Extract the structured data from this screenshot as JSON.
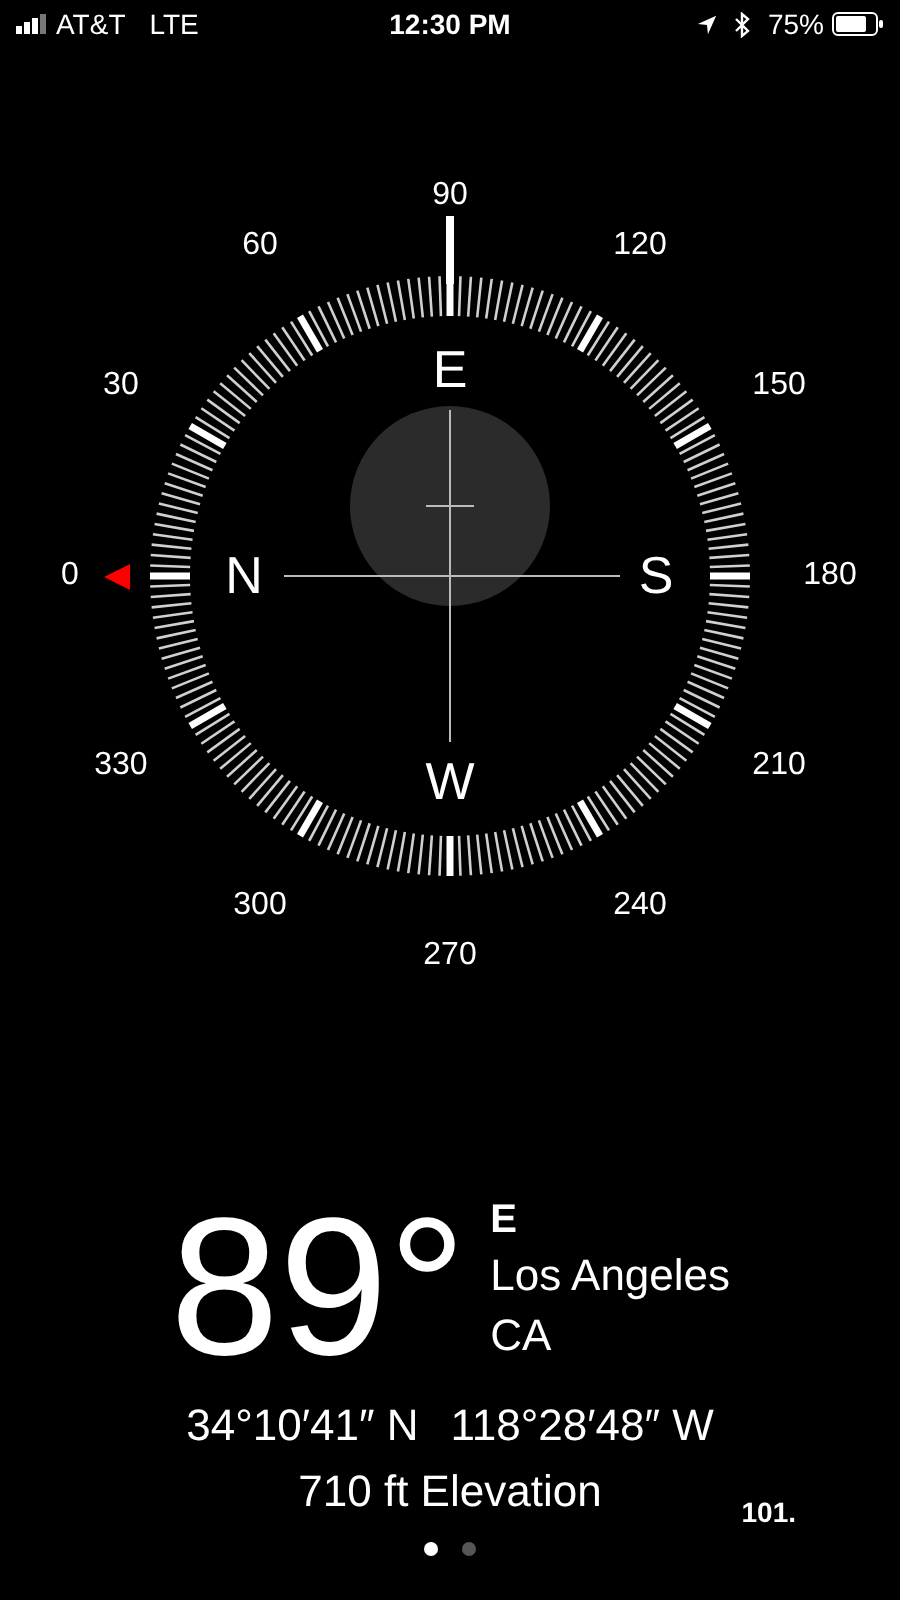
{
  "status_bar": {
    "carrier": "AT&T",
    "network": "LTE",
    "time": "12:30 PM",
    "battery": "75%"
  },
  "compass": {
    "degree_labels": [
      "0",
      "30",
      "60",
      "90",
      "120",
      "150",
      "180",
      "210",
      "240",
      "270",
      "300",
      "330"
    ],
    "cardinals": [
      "N",
      "E",
      "S",
      "W"
    ]
  },
  "heading": {
    "degrees": "89°",
    "direction": "E",
    "city": "Los Angeles",
    "region": "CA",
    "coordinates": [
      "34°10′41″ N",
      "118°28′48″ W"
    ],
    "elevation": "710 ft Elevation"
  },
  "corner_label": "101.",
  "pages": [
    {
      "selected": true
    },
    {
      "selected": false
    }
  ]
}
